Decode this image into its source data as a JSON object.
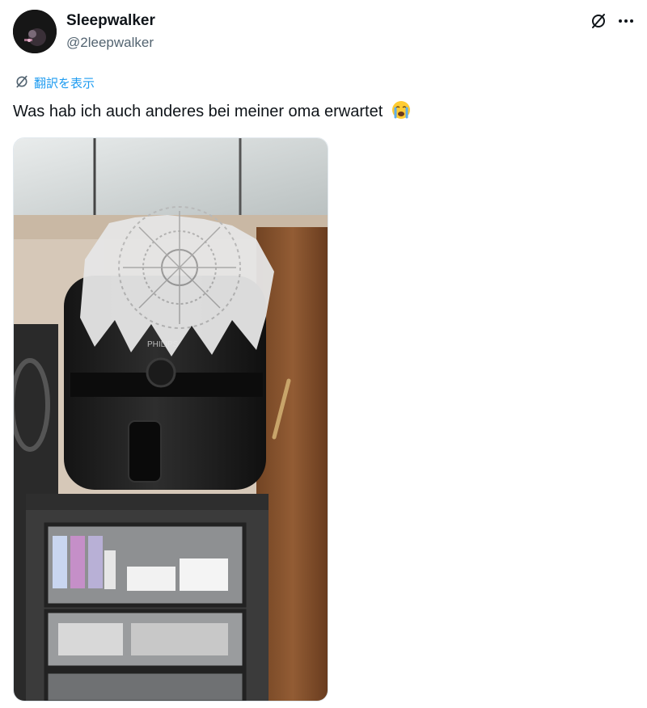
{
  "author": {
    "display_name": "Sleepwalker",
    "handle": "@2leepwalker",
    "avatar_icon": "avatar-photo"
  },
  "header_actions": {
    "grok_icon": "slash-circle-icon",
    "more_icon": "more-dots-icon",
    "more_glyph": "···"
  },
  "translate": {
    "icon": "slash-circle-icon",
    "label": "翻訳を表示",
    "color": "#1d9bf0"
  },
  "tweet": {
    "text": "Was hab ich auch anderes bei meiner oma erwartet",
    "emoji": "loudly-crying-face-emoji"
  },
  "media": {
    "type": "photo",
    "brand_text": "PHILIPS"
  },
  "colors": {
    "text": "#0f1419",
    "secondary": "#536471",
    "link": "#1d9bf0"
  }
}
